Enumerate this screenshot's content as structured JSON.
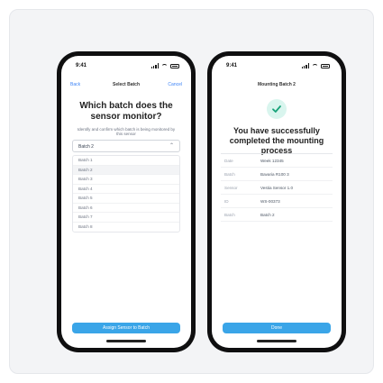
{
  "phone_left": {
    "status": {
      "time": "9:41"
    },
    "nav": {
      "back": "Back",
      "title": "Select Batch",
      "cancel": "Cancel"
    },
    "question": "Which batch does the sensor monitor?",
    "hint": "Identify and confirm which batch is being monitored by this sensor",
    "select": {
      "value": "Batch 2",
      "chevron_icon": "chevron-up-icon"
    },
    "options": [
      "Batch 1",
      "Batch 2",
      "Batch 3",
      "Batch 4",
      "Batch 5",
      "Batch 6",
      "Batch 7",
      "Batch 8"
    ],
    "selected_option_index": 1,
    "primary_button": "Assign Sensor to Batch"
  },
  "phone_right": {
    "status": {
      "time": "9:41"
    },
    "nav": {
      "title": "Mounting Batch 2"
    },
    "check_icon": "check-circle-icon",
    "message": "You have successfully completed the mounting process",
    "details": [
      {
        "k": "Date",
        "v": "Week 12345"
      },
      {
        "k": "Batch",
        "v": "Bavaria R100 3"
      },
      {
        "k": "Sensor",
        "v": "Vestia Sensor 1.0"
      },
      {
        "k": "ID",
        "v": "WS-00373"
      },
      {
        "k": "Batch",
        "v": "Batch 2"
      }
    ],
    "primary_button": "Done"
  },
  "colors": {
    "accent": "#3aa5e8",
    "success_bg": "#d9f5ee",
    "success_check": "#18a37a",
    "link": "#3b82f6"
  }
}
